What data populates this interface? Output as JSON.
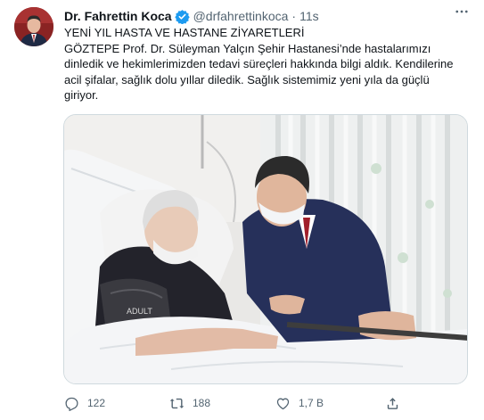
{
  "author": {
    "name": "Dr. Fahrettin Koca",
    "handle": "@drfahrettinkoca",
    "separator": "·",
    "time": "11s"
  },
  "tweet": {
    "text": "YENİ YIL HASTA VE HASTANE ZİYARETLERİ\nGÖZTEPE Prof. Dr. Süleyman Yalçın Şehir Hastanesi’nde hastalarımızı dinledik ve hekimlerimizden tedavi süreçleri hakkında bilgi aldık. Kendilerine acil şifalar, sağlık dolu yıllar diledik. Sağlık sistemimiz yeni yıla da güçlü giriyor.",
    "media_wristband_text": "ADULT"
  },
  "actions": {
    "replies": "122",
    "retweets": "188",
    "likes": "1,7 B"
  },
  "icons": {
    "verified": "verified-badge-icon",
    "more": "more-options-icon",
    "reply": "reply-icon",
    "retweet": "retweet-icon",
    "like": "heart-icon",
    "share": "share-icon"
  },
  "colors": {
    "verified": "#1d9bf0",
    "muted": "#536471",
    "text": "#0f1419"
  }
}
